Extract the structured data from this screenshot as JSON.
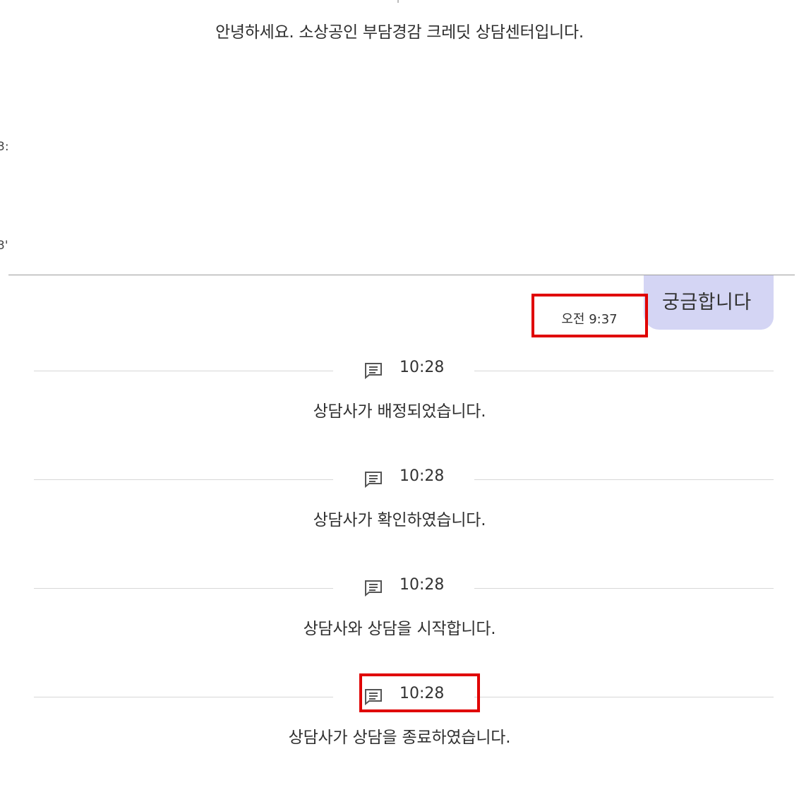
{
  "greeting": "안녕하세요. 소상공인 부담경감 크레딧 상담센터입니다.",
  "edge_fragments": [
    "3:",
    "3'"
  ],
  "user_message": {
    "text": "궁금합니다",
    "timestamp": "오전 9:37",
    "bubble_color": "#d4d5f4"
  },
  "system_events": [
    {
      "icon": "chat-message-icon",
      "time": "10:28",
      "message": "상담사가 배정되었습니다."
    },
    {
      "icon": "chat-message-icon",
      "time": "10:28",
      "message": "상담사가 확인하였습니다."
    },
    {
      "icon": "chat-message-icon",
      "time": "10:28",
      "message": "상담사와 상담을 시작합니다."
    },
    {
      "icon": "chat-message-icon",
      "time": "10:28",
      "message": "상담사가 상담을 종료하였습니다."
    }
  ],
  "highlight_color": "#e00000"
}
